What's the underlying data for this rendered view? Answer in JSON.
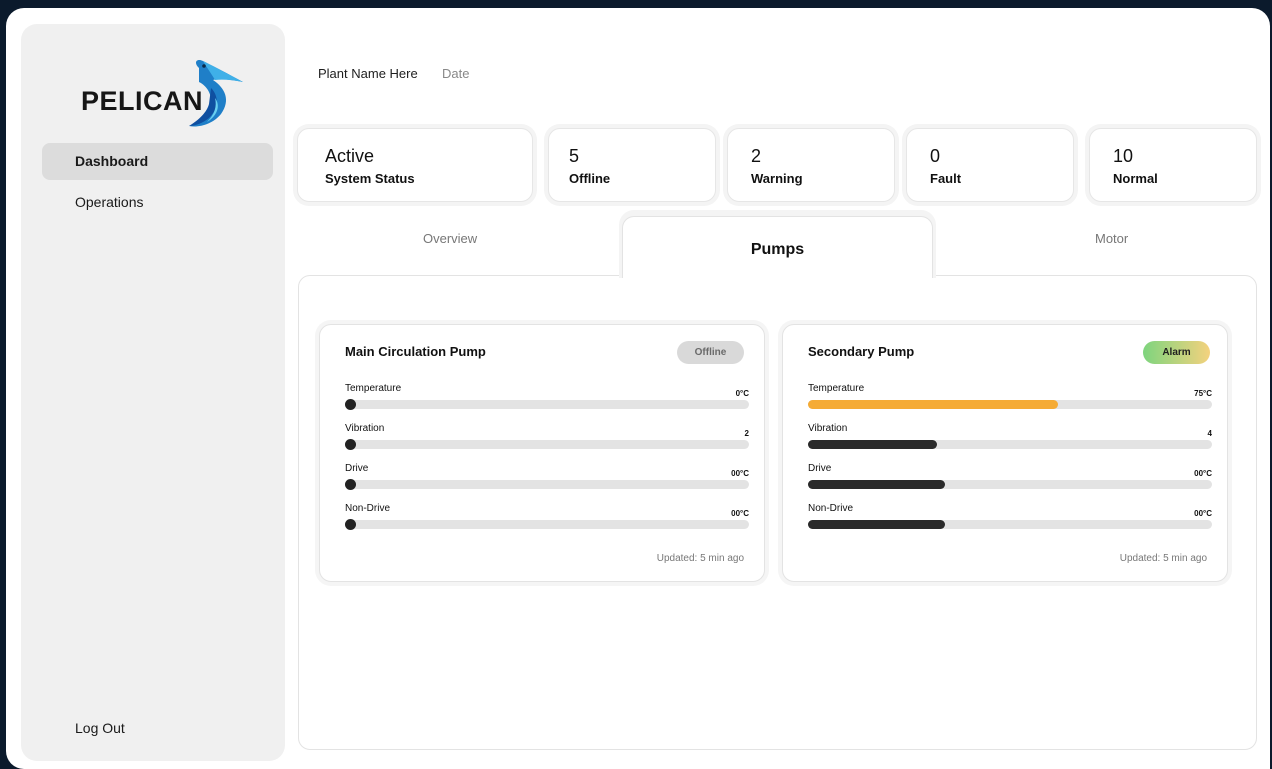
{
  "brand": {
    "logo_text": "PELICAN"
  },
  "sidebar": {
    "items": [
      {
        "label": "Dashboard"
      },
      {
        "label": "Operations"
      }
    ],
    "logout_label": "Log Out"
  },
  "header": {
    "plant_name": "Plant Name Here",
    "date": "Date"
  },
  "stats": [
    {
      "value": "Active",
      "label": "System Status"
    },
    {
      "value": "5",
      "label": "Offline"
    },
    {
      "value": "2",
      "label": "Warning"
    },
    {
      "value": "0",
      "label": "Fault"
    },
    {
      "value": "10",
      "label": "Normal"
    }
  ],
  "tabs": [
    {
      "label": "Overview"
    },
    {
      "label": "Pumps"
    },
    {
      "label": "Motor"
    }
  ],
  "pumps": [
    {
      "title": "Main Circulation Pump",
      "status": "Offline",
      "updated": "Updated: 5 min ago",
      "metrics": [
        {
          "label": "Temperature",
          "value": "0°C",
          "level": 0,
          "color": "#222222"
        },
        {
          "label": "Vibration",
          "value": "2",
          "level": 0,
          "color": "#222222"
        },
        {
          "label": "Drive",
          "value": "00°C",
          "level": 0,
          "color": "#222222"
        },
        {
          "label": "Non-Drive",
          "value": "00°C",
          "level": 0,
          "color": "#222222"
        }
      ]
    },
    {
      "title": "Secondary Pump",
      "status": "Alarm",
      "updated": "Updated: 5 min ago",
      "metrics": [
        {
          "label": "Temperature",
          "value": "75°C",
          "level": 0.62,
          "color": "#f5ab35"
        },
        {
          "label": "Vibration",
          "value": "4",
          "level": 0.32,
          "color": "#2a2a2a"
        },
        {
          "label": "Drive",
          "value": "00°C",
          "level": 0.34,
          "color": "#2a2a2a"
        },
        {
          "label": "Non-Drive",
          "value": "00°C",
          "level": 0.34,
          "color": "#2a2a2a"
        }
      ]
    }
  ],
  "colors": {
    "background": "#0b1a2c",
    "sidebar": "#f0f0f0",
    "alarm_gradient_start": "#7ed47e",
    "alarm_gradient_end": "#f4d27e",
    "warning_bar": "#f5ab35"
  }
}
